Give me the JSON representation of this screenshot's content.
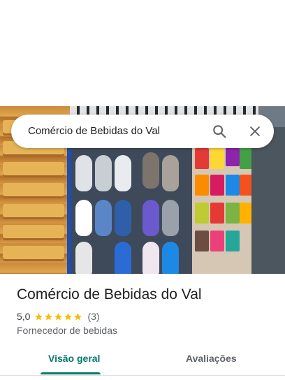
{
  "search": {
    "query": "Comércio de Bebidas do Val"
  },
  "place": {
    "name": "Comércio de Bebidas do Val",
    "rating": "5,0",
    "stars": 5,
    "review_count": "(3)",
    "category": "Fornecedor de bebidas"
  },
  "tabs": [
    {
      "label": "Visão geral",
      "active": true
    },
    {
      "label": "Avaliações",
      "active": false
    }
  ],
  "colors": {
    "accent": "#00796b",
    "star": "#fbbc04",
    "text_primary": "#202124",
    "text_secondary": "#5f6368"
  },
  "icons": {
    "search": "search-icon",
    "close": "close-icon",
    "star": "star-icon"
  }
}
